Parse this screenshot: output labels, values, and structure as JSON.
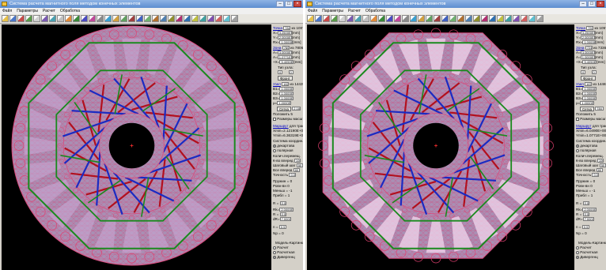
{
  "window_title": "Система расчета магнитного поля методом конечных элементов",
  "window_title_short": "Система расчета магнитного поля методом конечных элементов",
  "menu": [
    "Файл",
    "Параметры",
    "Расчет",
    "Обработка"
  ],
  "colors": {
    "mesh_fill": "#a98fb4",
    "mesh_line": "#e2346a",
    "red_wire": "#b2101e",
    "blue_wire": "#1b2bc2",
    "green_frame": "#1a8a1e",
    "background": "#000000"
  },
  "panel1": {
    "tochka_label": "Точка",
    "tochka_value": "784",
    "tochka_of": "из 1007",
    "x_label": "X=",
    "x_value": "3.2500E+00",
    "y_label": "Y=",
    "y_value": "2.0000E+00",
    "rx_label": "Rx=",
    "rx_value": "1.0000E+01",
    "unit_mm": "[mm]",
    "zona_label": "Зона",
    "zona_value": "7807",
    "zona_of": "из 7806",
    "a_label": "A=",
    "a_value": "3.0000E+00",
    "ax_label": "A=",
    "ax_value": "1.0771E+00",
    "xpos_label": "+X=",
    "xpos_value": "5.4050E+00",
    "vid_label": "Тип узла:",
    "vid_left": "0",
    "vid_right": "0",
    "gran_label": "Фронт",
    "node_label": "Узел",
    "node_value": "1622",
    "node_of": "из 14439",
    "b1_label": "B1=",
    "b1_value": "1.0000E+00",
    "b2_label": "B2=",
    "b2_value": "1.0000E+00",
    "b3_label": "B3=",
    "b3_value": "1.0000E+00",
    "mu_label": "μ=",
    "mu_value": "1.0000E+00",
    "setka_btn": "Сетка",
    "setka_value": "2.180",
    "points_label": "Положить 5",
    "razm_label": "Размеры масштаба",
    "kontur_label": "Маршрут",
    "kontur_hint": "для трассы",
    "xmin_label": "Xmin=",
    "xmin_value": "2.12190E+000mm",
    "ymin_label": "Ymin=",
    "ymin_value": "6.36319E+000mm",
    "sistema_label": "Система координ.:",
    "dekart_label": "декартова",
    "polar_label": "полярная",
    "kol_label": "Колич.перемещ.",
    "kol_value": "10",
    "kol2_label": "К-во вперед",
    "kol2_value": "100",
    "shag_label": "Шаговый шаг",
    "shag_value": "50",
    "vse_label": "Все вперед",
    "vse_value": "80",
    "tochn_label": "Точность",
    "tochn_value": "0.00",
    "pruj_label": "Пружин =",
    "pruj_value": "0",
    "ravn_label": "Ровн-вн",
    "ravn_value": "0",
    "men_label": "Меньш =",
    "men_value": "-1",
    "plus_label": "Прибл =",
    "plus_value": "1",
    "r_label": "R =",
    "r_value": "0.0",
    "rx2_label": "Rk=",
    "rx2_value": "2.0000E+00",
    "r2_label": "R =",
    "r2_value": "0.0",
    "dr_label": "dR=",
    "dr_value": "7.0000",
    "n_label": "n =",
    "n_value": "0.5",
    "nmax_label": "Np =",
    "nmax_value": "0",
    "mode_title": "Модель-Картинки",
    "mode1": "Расчет",
    "mode2": "Расчетная",
    "mode3": "Дивергенц"
  },
  "panel2": {
    "tochka_label": "Точка",
    "tochka_value": "797",
    "tochka_of": "из 1057",
    "x_label": "X=",
    "x_value": "3.2500E+00",
    "y_label": "Y=",
    "y_value": "2.0000E+00",
    "rx_label": "Rx=",
    "rx_value": "1.0000E+01",
    "unit_mm": "[mm]",
    "zona_label": "Зона",
    "zona_value": "7240",
    "zona_of": "из 7336",
    "a_label": "A=",
    "a_value": "3.0000E+00",
    "ax_label": "A=",
    "ax_value": "1.0000E+00",
    "xpos_label": "+X=",
    "xpos_value": "5.4050E+00",
    "vid_label": "Тип узла:",
    "vid_left": "0",
    "vid_right": "0",
    "gran_label": "Фронт",
    "node_label": "Узел",
    "node_value": "1670",
    "node_of": "из 14483",
    "b1_label": "B1=",
    "b1_value": "1.0000E+00",
    "b2_label": "B2=",
    "b2_value": "1.0000E+00",
    "b3_label": "B3=",
    "b3_value": "1.0000E+00",
    "mu_label": "μ=",
    "mu_value": "1.0000E+00",
    "setka_btn": "Сетка",
    "setka_value": "784",
    "points_label": "Положить 5",
    "razm_label": "Размеры масштаба",
    "kontur_label": "Маршрут",
    "kontur_hint": "для трассы",
    "xmin_label": "Xmin=",
    "xmin_value": "6.0490E+000mm",
    "ymin_label": "Ymin=",
    "ymin_value": "1.0771E+000mm",
    "sistema_label": "Система координ.:",
    "dekart_label": "декартова",
    "polar_label": "полярная",
    "kol_label": "Колич.перемещ.",
    "kol_value": "10",
    "kol2_label": "К-во вперед",
    "kol2_value": "100",
    "shag_label": "Шаговый шаг",
    "shag_value": "50",
    "vse_label": "Все вперед",
    "vse_value": "80",
    "tochn_label": "Точность",
    "tochn_value": "0.00",
    "pruj_label": "Пружин =",
    "pruj_value": "0",
    "ravn_label": "Ровн-вн",
    "ravn_value": "0",
    "men_label": "Меньш =",
    "men_value": "-1",
    "plus_label": "Прибл =",
    "plus_value": "1",
    "r_label": "R =",
    "r_value": "0.0",
    "rx2_label": "Rk=",
    "rx2_value": "2.0000E+00",
    "r2_label": "R =",
    "r2_value": "0.0",
    "dr_label": "dR=",
    "dr_value": "7.0000",
    "n_label": "n =",
    "n_value": "0.5",
    "nmax_label": "Np =",
    "nmax_value": "0",
    "mode_title": "Модель-Картинки",
    "mode1": "Расчет",
    "mode2": "Расчетная",
    "mode3": "Дивергенц"
  }
}
